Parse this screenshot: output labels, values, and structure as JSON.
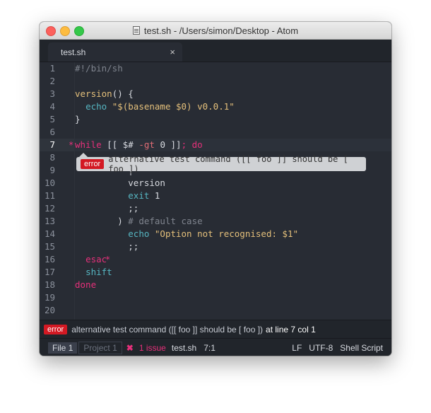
{
  "window": {
    "title": "test.sh - /Users/simon/Desktop - Atom"
  },
  "tabs": [
    {
      "label": "test.sh",
      "close": "×"
    }
  ],
  "editor": {
    "line_numbers": [
      "1",
      "2",
      "3",
      "4",
      "5",
      "6",
      "7",
      "8",
      "9",
      "10",
      "11",
      "12",
      "13",
      "14",
      "15",
      "16",
      "17",
      "18",
      "19",
      "20"
    ],
    "active_line": "7",
    "lines": [
      {
        "n": 1,
        "parts": [
          {
            "t": "#!/bin/sh",
            "c": "c-comment"
          }
        ]
      },
      {
        "n": 2,
        "parts": []
      },
      {
        "n": 3,
        "parts": [
          {
            "t": "version",
            "c": "c-fn"
          },
          {
            "t": "() {",
            "c": "c-plain"
          }
        ]
      },
      {
        "n": 4,
        "parts": [
          {
            "t": "  ",
            "c": "c-plain"
          },
          {
            "t": "echo",
            "c": "c-cyan"
          },
          {
            "t": " \"$(basename $0) v0.0.1\"",
            "c": "c-str"
          }
        ]
      },
      {
        "n": 5,
        "parts": [
          {
            "t": "}",
            "c": "c-plain"
          }
        ]
      },
      {
        "n": 6,
        "parts": []
      },
      {
        "n": 7,
        "parts": [
          {
            "t": "while",
            "c": "c-pink"
          },
          {
            "t": " [[ ",
            "c": "c-plain"
          },
          {
            "t": "$#",
            "c": "c-plain"
          },
          {
            "t": " -gt ",
            "c": "c-red"
          },
          {
            "t": "0",
            "c": "c-plain"
          },
          {
            "t": " ]]",
            "c": "c-plain"
          },
          {
            "t": "; do",
            "c": "c-pink"
          }
        ]
      },
      {
        "n": 8,
        "parts": []
      },
      {
        "n": 9,
        "parts": [
          {
            "t": "          ",
            "c": "c-plain"
          },
          {
            "t": "|",
            "c": "c-plain"
          }
        ]
      },
      {
        "n": 10,
        "parts": [
          {
            "t": "          version",
            "c": "c-plain"
          }
        ]
      },
      {
        "n": 11,
        "parts": [
          {
            "t": "          ",
            "c": "c-plain"
          },
          {
            "t": "exit",
            "c": "c-cyan"
          },
          {
            "t": " 1",
            "c": "c-plain"
          }
        ]
      },
      {
        "n": 12,
        "parts": [
          {
            "t": "          ;;",
            "c": "c-plain"
          }
        ]
      },
      {
        "n": 13,
        "parts": [
          {
            "t": "        ) ",
            "c": "c-plain"
          },
          {
            "t": "# default case",
            "c": "c-comment"
          }
        ]
      },
      {
        "n": 14,
        "parts": [
          {
            "t": "          ",
            "c": "c-plain"
          },
          {
            "t": "echo",
            "c": "c-cyan"
          },
          {
            "t": " \"Option not recognised: $1\"",
            "c": "c-str"
          }
        ]
      },
      {
        "n": 15,
        "parts": [
          {
            "t": "          ;;",
            "c": "c-plain"
          }
        ]
      },
      {
        "n": 16,
        "parts": [
          {
            "t": "  ",
            "c": "c-plain"
          },
          {
            "t": "esac",
            "c": "c-pink"
          }
        ]
      },
      {
        "n": 17,
        "parts": [
          {
            "t": "  ",
            "c": "c-plain"
          },
          {
            "t": "shift",
            "c": "c-cyan"
          }
        ]
      },
      {
        "n": 18,
        "parts": [
          {
            "t": "done",
            "c": "c-pink"
          }
        ]
      },
      {
        "n": 19,
        "parts": []
      },
      {
        "n": 20,
        "parts": []
      }
    ],
    "error_marker": "*"
  },
  "tooltip": {
    "badge": "error",
    "message": "alternative test command ([[ foo ]] should be [ foo ])"
  },
  "linter": {
    "badge": "error",
    "message": "alternative test command ([[ foo ]] should be [ foo ])",
    "location": "at line 7 col 1"
  },
  "statusbar": {
    "file_label": "File",
    "file_count": "1",
    "project_label": "Project",
    "project_count": "1",
    "issue_icon": "✖",
    "issue_text": "1 issue",
    "filename": "test.sh",
    "cursor": "7:1",
    "line_ending": "LF",
    "encoding": "UTF-8",
    "grammar": "Shell Script"
  },
  "colors": {
    "error_red": "#d31923",
    "marker_pink": "#e5307a",
    "editor_bg": "#282c34"
  }
}
